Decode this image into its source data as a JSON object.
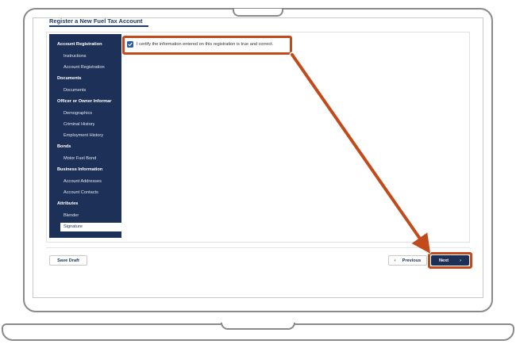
{
  "page": {
    "title": "Register a New Fuel Tax Account"
  },
  "sidebar": {
    "items": [
      {
        "label": "Account Registration",
        "kind": "section"
      },
      {
        "label": "Instructions",
        "kind": "sub"
      },
      {
        "label": "Account Registration",
        "kind": "sub"
      },
      {
        "label": "Documents",
        "kind": "section"
      },
      {
        "label": "Documents",
        "kind": "sub"
      },
      {
        "label": "Officer or Owner Informar",
        "kind": "section"
      },
      {
        "label": "Demographics",
        "kind": "sub"
      },
      {
        "label": "Criminal History",
        "kind": "sub"
      },
      {
        "label": "Employment History",
        "kind": "sub"
      },
      {
        "label": "Bonds",
        "kind": "section"
      },
      {
        "label": "Motor Fuel Bond",
        "kind": "sub"
      },
      {
        "label": "Business Information",
        "kind": "section"
      },
      {
        "label": "Account Addresses",
        "kind": "sub"
      },
      {
        "label": "Account Contacts",
        "kind": "sub"
      },
      {
        "label": "Attributes",
        "kind": "section"
      },
      {
        "label": "Blender",
        "kind": "sub"
      }
    ],
    "active_item": "Signature"
  },
  "form": {
    "certify_label": "I certify the information entered on this registration is true and correct.",
    "certify_checked": true
  },
  "footer": {
    "save_draft": "Save Draft",
    "previous": "Previous",
    "next": "Next"
  },
  "colors": {
    "navy": "#1d3057",
    "highlight": "#c24b1c",
    "checkbox": "#2c5aa0"
  },
  "icons": {
    "prev": "chevron-left-icon",
    "next": "chevron-right-icon",
    "check": "checkmark-icon"
  }
}
